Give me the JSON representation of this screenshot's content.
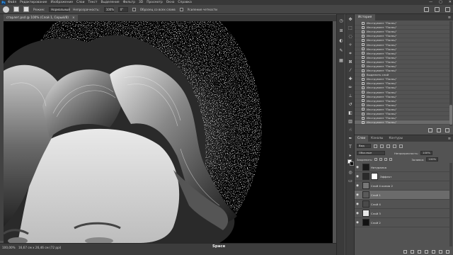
{
  "menubar": {
    "logo": "Ps",
    "items": [
      "Файл",
      "Редактирование",
      "Изображение",
      "Слои",
      "Текст",
      "Выделение",
      "Фильтр",
      "3D",
      "Просмотр",
      "Окно",
      "Справка"
    ],
    "window_controls": [
      "—",
      "▢",
      "✕"
    ]
  },
  "options": {
    "mode_label": "Режим:",
    "mode_value": "Нормальный",
    "opacity_label": "Непрозрачность:",
    "opacity_value": "100%",
    "size_value": "0°",
    "sample_all": "Образец со всех слоев",
    "protect_detail": "Усиление четкости"
  },
  "document": {
    "tab_title": "старлет.psd @ 100% (Слой 1, Серый/8)",
    "close": "×"
  },
  "canvas": {
    "hint": "Space"
  },
  "status": {
    "zoom": "100,00%",
    "dims": "16,67 см x 26,46 см (72 ppi)",
    "key": "Space"
  },
  "history": {
    "title": "История",
    "items": [
      "Инструмент \"Палец\"",
      "Инструмент \"Палец\"",
      "Инструмент \"Палец\"",
      "Инструмент \"Палец\"",
      "Инструмент \"Палец\"",
      "Инструмент \"Палец\"",
      "Инструмент \"Палец\"",
      "Инструмент \"Палец\"",
      "Инструмент \"Палец\"",
      "Инструмент \"Палец\"",
      "Инструмент \"Палец\"",
      "Инструмент \"Палец\"",
      "Выделить слой",
      "Инструмент \"Палец\"",
      "Инструмент \"Палец\"",
      "Инструмент \"Палец\"",
      "Инструмент \"Палец\"",
      "Инструмент \"Палец\"",
      "Инструмент \"Палец\"",
      "Инструмент \"Палец\"",
      "Инструмент \"Палец\"",
      "Инструмент \"Палец\"",
      "Инструмент \"Палец\"",
      "Инструмент \"Палец\""
    ]
  },
  "layers": {
    "tabs": [
      "Слои",
      "Каналы",
      "Контуры"
    ],
    "filter_kind": "Вид",
    "blend_mode": "Обычные",
    "opacity_label": "Непрозрачность:",
    "opacity_value": "100%",
    "lock_label": "Закрепить:",
    "fill_label": "Заливка:",
    "fill_value": "100%",
    "items": [
      {
        "name": "Натуралка",
        "thumb": "#1a1a1a",
        "mask": false
      },
      {
        "name": "Эффект",
        "thumb": "#2a2a2a",
        "mask": true
      },
      {
        "name": "Слой 4 копия 2",
        "thumb": "#777777",
        "mask": false
      },
      {
        "name": "Слой 1",
        "thumb": "#5a5a5a",
        "mask": false
      },
      {
        "name": "Слой 4",
        "thumb": "#4a4a4a",
        "mask": false
      },
      {
        "name": "Слой 3",
        "thumb": "#e8e8e8",
        "mask": false
      },
      {
        "name": "Слой 2",
        "thumb": "#111111",
        "mask": false
      }
    ]
  }
}
